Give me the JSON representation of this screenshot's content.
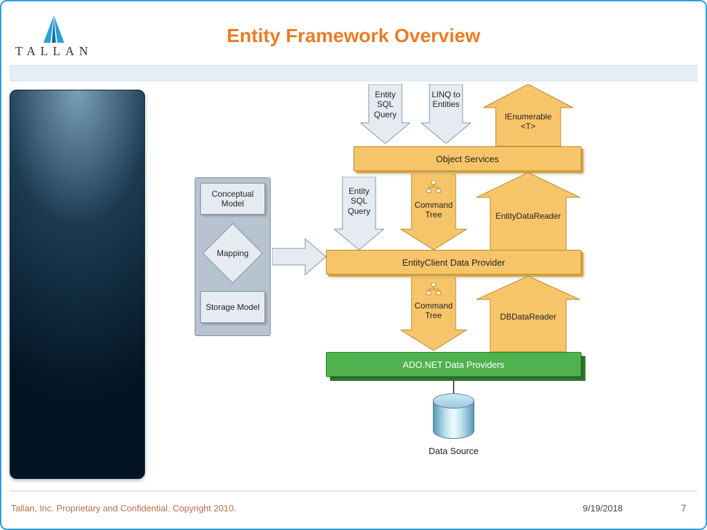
{
  "meta": {
    "logo_text": "TALLAN",
    "title": "Entity Framework Overview",
    "footer_text": "Tallan, Inc. Proprietary and Confidential. Copyright 2010.",
    "date": "9/19/2018",
    "page_number": "7"
  },
  "diagram": {
    "edm_group": {
      "conceptual": "Conceptual Model",
      "mapping": "Mapping",
      "storage": "Storage Model"
    },
    "top_row": {
      "entity_sql_query": "Entity SQL Query",
      "linq_to_entities": "LINQ to Entities",
      "ienumerable": "IEnumerable <T>"
    },
    "layers": {
      "object_services": "Object Services",
      "entity_client": "EntityClient Data Provider",
      "ado_net": "ADO.NET Data Providers",
      "data_source": "Data Source"
    },
    "mid_arrows": {
      "entity_sql_query": "Entity SQL Query",
      "command_tree_1": "Command Tree",
      "entity_data_reader": "EntityDataReader",
      "command_tree_2": "Command Tree",
      "db_data_reader": "DBDataReader"
    }
  }
}
